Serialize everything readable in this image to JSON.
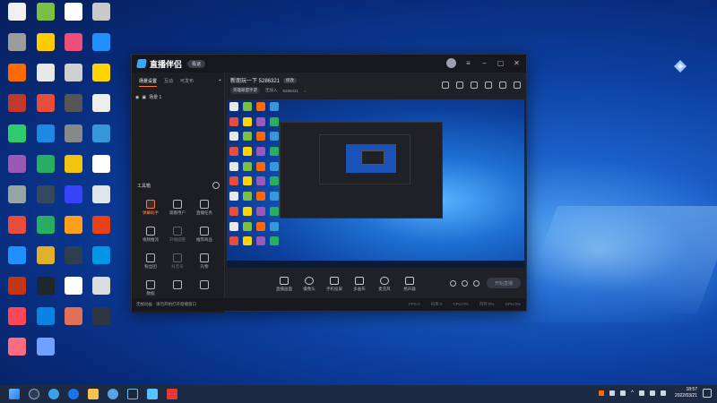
{
  "desktop_icons": [
    {
      "label": "",
      "color": "#f0f0f0"
    },
    {
      "label": "",
      "color": "#7ac143"
    },
    {
      "label": "",
      "color": "#ffffff"
    },
    {
      "label": "",
      "color": "#c9c9c9"
    },
    {
      "label": "",
      "color": "#9c9c9c"
    },
    {
      "label": "",
      "color": "#ffcc00"
    },
    {
      "label": "",
      "color": "#f04e7a"
    },
    {
      "label": "",
      "color": "#1e90ff"
    },
    {
      "label": "",
      "color": "#ff6a00"
    },
    {
      "label": "",
      "color": "#e8e8e8"
    },
    {
      "label": "",
      "color": "#cfcfcf"
    },
    {
      "label": "",
      "color": "#ffd400"
    },
    {
      "label": "",
      "color": "#c0392b"
    },
    {
      "label": "",
      "color": "#e74c3c"
    },
    {
      "label": "",
      "color": "#555555"
    },
    {
      "label": "",
      "color": "#eeeeee"
    },
    {
      "label": "",
      "color": "#2ecc71"
    },
    {
      "label": "",
      "color": "#1e88e5"
    },
    {
      "label": "",
      "color": "#888888"
    },
    {
      "label": "",
      "color": "#3498db"
    },
    {
      "label": "",
      "color": "#9b59b6"
    },
    {
      "label": "",
      "color": "#27ae60"
    },
    {
      "label": "",
      "color": "#f1c40f"
    },
    {
      "label": "",
      "color": "#ffffff"
    },
    {
      "label": "",
      "color": "#95a5a6"
    },
    {
      "label": "",
      "color": "#34495e"
    },
    {
      "label": "",
      "color": "#3742fa"
    },
    {
      "label": "",
      "color": "#dfe6e9"
    },
    {
      "label": "",
      "color": "#e74c3c"
    },
    {
      "label": "",
      "color": "#27ae60"
    },
    {
      "label": "",
      "color": "#ff9f1a"
    },
    {
      "label": "",
      "color": "#e84118"
    },
    {
      "label": "",
      "color": "#1e90ff"
    },
    {
      "label": "",
      "color": "#e1b12c"
    },
    {
      "label": "",
      "color": "#2c3e50"
    },
    {
      "label": "",
      "color": "#0097e6"
    },
    {
      "label": "",
      "color": "#c23616"
    },
    {
      "label": "",
      "color": "#1e272e"
    },
    {
      "label": "",
      "color": "#ffffff"
    },
    {
      "label": "",
      "color": "#dcdde1"
    },
    {
      "label": "",
      "color": "#ff4757"
    },
    {
      "label": "",
      "color": "#0984e3"
    },
    {
      "label": "",
      "color": "#e17055"
    },
    {
      "label": "",
      "color": "#2f3542"
    },
    {
      "label": "",
      "color": "#ff6b81"
    },
    {
      "label": "",
      "color": "#70a1ff"
    }
  ],
  "window": {
    "brand": "直播伴侣",
    "version_pill": "极速",
    "tabs": [
      "场景设置",
      "互动",
      "可发布"
    ],
    "scene_item": "场景 1",
    "toolbox_title": "工具箱",
    "tools": [
      {
        "label": "弹幕助手",
        "style": "orange"
      },
      {
        "label": "观看用户",
        "style": ""
      },
      {
        "label": "直播任务",
        "style": ""
      },
      {
        "label": "视频推流",
        "style": ""
      },
      {
        "label": "开播提醒",
        "style": "dim"
      },
      {
        "label": "推荐商品",
        "style": ""
      },
      {
        "label": "粉丝团",
        "style": ""
      },
      {
        "label": "抖音号",
        "style": "dim"
      },
      {
        "label": "礼物",
        "style": ""
      },
      {
        "label": "数据",
        "style": ""
      },
      {
        "label": "",
        "style": ""
      },
      {
        "label": "",
        "style": ""
      }
    ],
    "room": {
      "title": "新朋玩一下 5286321",
      "edit": "修改",
      "category": "英雄联盟手游",
      "status": "无加入",
      "id": "5286321"
    },
    "controls": [
      "直播画面",
      "摄像头",
      "手机投屏",
      "多画布",
      "麦克风",
      "扬声器"
    ],
    "start_button": "开始直播",
    "status_text": "无帧动画 · 请勿开始打开窗播窗口",
    "status_right": [
      "FPS:0",
      "码率:0",
      "CPU:0%",
      "内存:0%",
      "GPU:0%"
    ]
  },
  "clock": {
    "time": "18:57",
    "date": "2022/03/21"
  }
}
